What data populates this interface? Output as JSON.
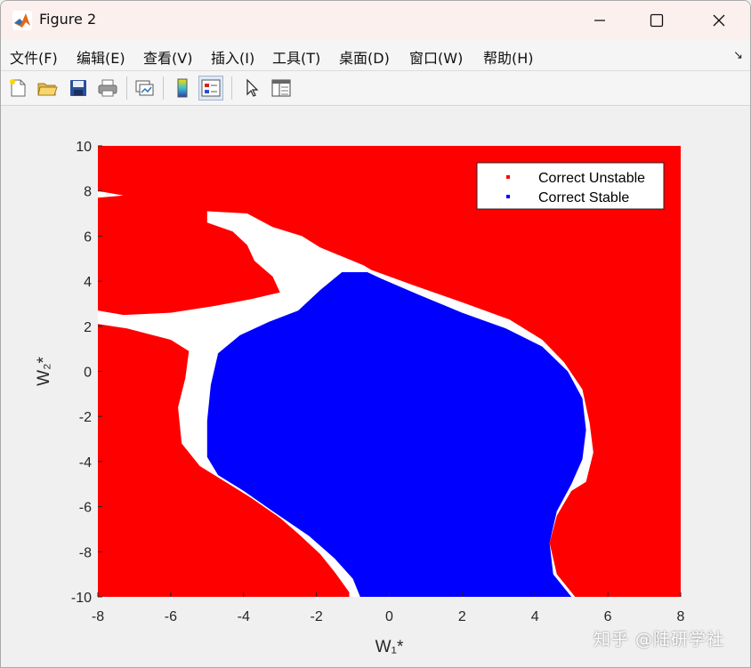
{
  "window": {
    "title": "Figure 2",
    "controls": {
      "minimize": "minimize-icon",
      "maximize": "maximize-icon",
      "close": "close-icon"
    }
  },
  "menu": {
    "items": [
      "文件(F)",
      "编辑(E)",
      "查看(V)",
      "插入(I)",
      "工具(T)",
      "桌面(D)",
      "窗口(W)",
      "帮助(H)"
    ],
    "overflow_glyph": "↘"
  },
  "toolbar": {
    "icons": [
      "new-figure-icon",
      "open-file-icon",
      "save-icon",
      "print-icon",
      "link-plot-icon",
      "colorbar-icon",
      "legend-icon",
      "pointer-icon",
      "property-inspector-icon"
    ]
  },
  "chart_data": {
    "type": "scatter",
    "title": "",
    "xlabel": "W₁*",
    "ylabel": "W₂*",
    "xlim": [
      -8,
      8
    ],
    "ylim": [
      -10,
      10
    ],
    "xticks": [
      -8,
      -6,
      -4,
      -2,
      0,
      2,
      4,
      6,
      8
    ],
    "yticks": [
      -10,
      -8,
      -6,
      -4,
      -2,
      0,
      2,
      4,
      6,
      8,
      10
    ],
    "grid": false,
    "legend_position": "top-right",
    "series": [
      {
        "name": "Correct Unstable",
        "color": "#ff0000"
      },
      {
        "name": "Correct Stable",
        "color": "#0000ff"
      }
    ],
    "stable_region_boundary": [
      [
        -1.3,
        4.4
      ],
      [
        -1.9,
        3.6
      ],
      [
        -2.5,
        2.7
      ],
      [
        -3.3,
        2.2
      ],
      [
        -4.1,
        1.6
      ],
      [
        -4.7,
        0.8
      ],
      [
        -4.9,
        -0.6
      ],
      [
        -5.0,
        -2.2
      ],
      [
        -5.0,
        -3.8
      ],
      [
        -4.7,
        -4.6
      ],
      [
        -4.0,
        -5.3
      ],
      [
        -3.2,
        -6.2
      ],
      [
        -2.2,
        -7.3
      ],
      [
        -1.5,
        -8.3
      ],
      [
        -1.0,
        -9.2
      ],
      [
        -0.8,
        -10.0
      ],
      [
        5.0,
        -10.0
      ],
      [
        4.5,
        -9.0
      ],
      [
        4.4,
        -7.6
      ],
      [
        4.6,
        -6.2
      ],
      [
        5.0,
        -5.0
      ],
      [
        5.3,
        -3.9
      ],
      [
        5.4,
        -2.6
      ],
      [
        5.3,
        -1.2
      ],
      [
        4.9,
        0.0
      ],
      [
        4.2,
        1.1
      ],
      [
        3.2,
        1.9
      ],
      [
        2.0,
        2.6
      ],
      [
        0.8,
        3.4
      ],
      [
        -0.2,
        4.1
      ],
      [
        -0.6,
        4.4
      ]
    ],
    "unstable_region_boundary": [
      [
        -8.0,
        10.0
      ],
      [
        8.0,
        10.0
      ],
      [
        8.0,
        -10.0
      ],
      [
        5.1,
        -10.0
      ],
      [
        4.6,
        -9.0
      ],
      [
        4.4,
        -7.6
      ],
      [
        4.6,
        -6.4
      ],
      [
        5.0,
        -5.3
      ],
      [
        5.4,
        -4.9
      ],
      [
        5.6,
        -3.6
      ],
      [
        5.5,
        -2.3
      ],
      [
        5.3,
        -0.8
      ],
      [
        4.8,
        0.4
      ],
      [
        4.2,
        1.4
      ],
      [
        3.3,
        2.3
      ],
      [
        2.1,
        3.0
      ],
      [
        0.7,
        3.8
      ],
      [
        -0.5,
        4.5
      ],
      [
        -0.7,
        4.7
      ],
      [
        -1.9,
        5.5
      ],
      [
        -2.4,
        6.0
      ],
      [
        -3.2,
        6.4
      ],
      [
        -3.9,
        7.0
      ],
      [
        -5.0,
        7.1
      ],
      [
        -5.0,
        6.6
      ],
      [
        -4.3,
        6.2
      ],
      [
        -3.9,
        5.6
      ],
      [
        -3.7,
        4.9
      ],
      [
        -3.2,
        4.2
      ],
      [
        -3.0,
        3.5
      ],
      [
        -3.8,
        3.2
      ],
      [
        -4.8,
        2.9
      ],
      [
        -6.0,
        2.6
      ],
      [
        -7.3,
        2.5
      ],
      [
        -8.0,
        2.7
      ],
      [
        -8.0,
        2.1
      ],
      [
        -7.2,
        1.9
      ],
      [
        -6.0,
        1.4
      ],
      [
        -5.5,
        0.9
      ],
      [
        -5.6,
        -0.3
      ],
      [
        -5.8,
        -1.6
      ],
      [
        -5.7,
        -3.2
      ],
      [
        -5.2,
        -4.2
      ],
      [
        -4.5,
        -4.9
      ],
      [
        -3.8,
        -5.6
      ],
      [
        -3.0,
        -6.5
      ],
      [
        -2.5,
        -7.2
      ],
      [
        -1.9,
        -8.1
      ],
      [
        -1.5,
        -8.9
      ],
      [
        -1.1,
        -9.8
      ],
      [
        -1.1,
        -10.0
      ],
      [
        -8.0,
        -10.0
      ],
      [
        -8.0,
        7.7
      ],
      [
        -7.3,
        7.8
      ],
      [
        -8.0,
        8.0
      ]
    ]
  },
  "watermark": "知乎 @陆研学社"
}
